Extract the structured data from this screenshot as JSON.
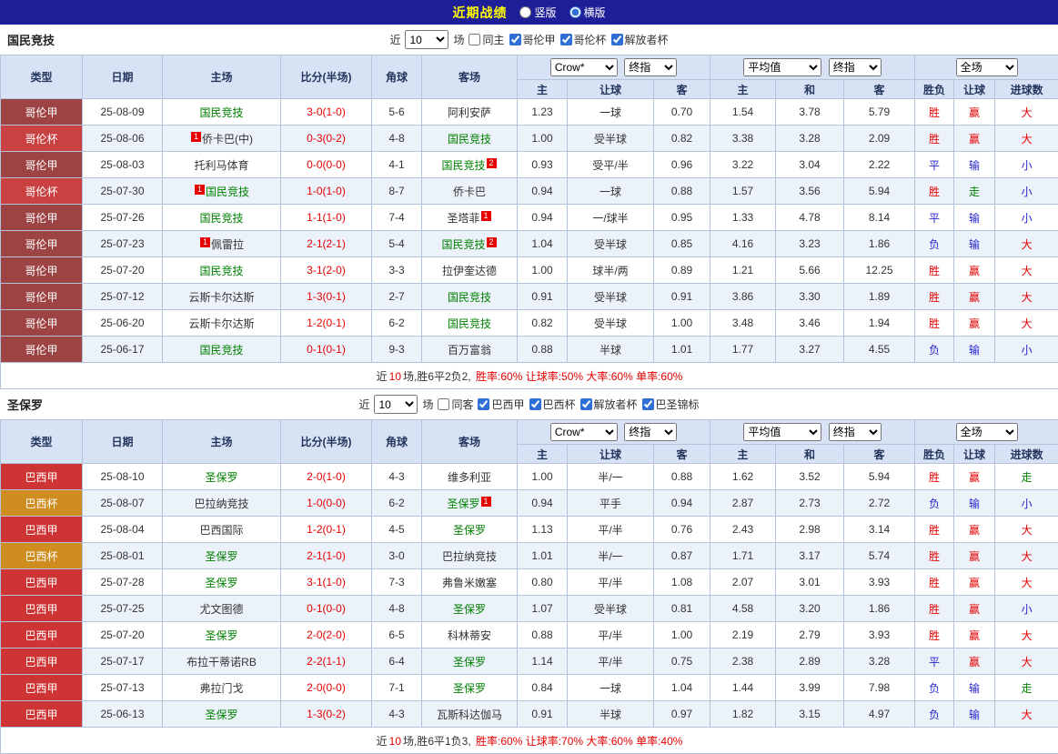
{
  "topbar": {
    "title": "近期战绩",
    "radios": [
      {
        "label": "竖版",
        "checked": false
      },
      {
        "label": "横版",
        "checked": true
      }
    ]
  },
  "columns": {
    "type": "类型",
    "date": "日期",
    "home": "主场",
    "score": "比分(半场)",
    "corner": "角球",
    "away": "客场",
    "odds_sub": [
      "主",
      "让球",
      "客"
    ],
    "avg_sub": [
      "主",
      "和",
      "客"
    ],
    "result_sub": [
      "胜负",
      "让球",
      "进球数"
    ]
  },
  "dropdowns": {
    "odds_company": "Crow*",
    "odds_final": "终指",
    "avg": "平均值",
    "avg_final": "终指",
    "scope": "全场"
  },
  "type_colors": {
    "哥伦甲": "#9e4343",
    "哥伦杯": "#c94141",
    "巴西甲": "#cf3434",
    "巴西杯": "#cf8c1f"
  },
  "sections": [
    {
      "team": "国民竞技",
      "filters": {
        "near": "近",
        "count": "10",
        "games": "场",
        "same": {
          "label": "同主",
          "checked": false
        },
        "leagues": [
          {
            "label": "哥伦甲",
            "checked": true
          },
          {
            "label": "哥伦杯",
            "checked": true
          },
          {
            "label": "解放者杯",
            "checked": true
          }
        ]
      },
      "rows": [
        {
          "type": "哥伦甲",
          "date": "25-08-09",
          "home": {
            "name": "国民竞技",
            "green": true
          },
          "score": "3-0(1-0)",
          "corner": "5-6",
          "away": {
            "name": "阿利安萨"
          },
          "odds": [
            "1.23",
            "一球",
            "0.70"
          ],
          "avg": [
            "1.54",
            "3.78",
            "5.79"
          ],
          "results": [
            [
              "胜",
              "red"
            ],
            [
              "赢",
              "red"
            ],
            [
              "大",
              "red"
            ]
          ]
        },
        {
          "type": "哥伦杯",
          "date": "25-08-06",
          "home": {
            "name": "侨卡巴(中)",
            "badge": "1",
            "badge_pos": "pre"
          },
          "score": "0-3(0-2)",
          "corner": "4-8",
          "away": {
            "name": "国民竞技",
            "green": true
          },
          "odds": [
            "1.00",
            "受半球",
            "0.82"
          ],
          "avg": [
            "3.38",
            "3.28",
            "2.09"
          ],
          "results": [
            [
              "胜",
              "red"
            ],
            [
              "赢",
              "red"
            ],
            [
              "大",
              "red"
            ]
          ]
        },
        {
          "type": "哥伦甲",
          "date": "25-08-03",
          "home": {
            "name": "托利马体育"
          },
          "score": "0-0(0-0)",
          "corner": "4-1",
          "away": {
            "name": "国民竞技",
            "green": true,
            "badge": "2",
            "badge_pos": "post"
          },
          "odds": [
            "0.93",
            "受平/半",
            "0.96"
          ],
          "avg": [
            "3.22",
            "3.04",
            "2.22"
          ],
          "results": [
            [
              "平",
              "blue"
            ],
            [
              "输",
              "blue"
            ],
            [
              "小",
              "blue"
            ]
          ]
        },
        {
          "type": "哥伦杯",
          "date": "25-07-30",
          "home": {
            "name": "国民竞技",
            "green": true,
            "badge": "1",
            "badge_pos": "pre"
          },
          "score": "1-0(1-0)",
          "corner": "8-7",
          "away": {
            "name": "侨卡巴"
          },
          "odds": [
            "0.94",
            "一球",
            "0.88"
          ],
          "avg": [
            "1.57",
            "3.56",
            "5.94"
          ],
          "results": [
            [
              "胜",
              "red"
            ],
            [
              "走",
              "green"
            ],
            [
              "小",
              "blue"
            ]
          ]
        },
        {
          "type": "哥伦甲",
          "date": "25-07-26",
          "home": {
            "name": "国民竞技",
            "green": true
          },
          "score": "1-1(1-0)",
          "corner": "7-4",
          "away": {
            "name": "圣塔菲",
            "badge": "1",
            "badge_pos": "post"
          },
          "odds": [
            "0.94",
            "一/球半",
            "0.95"
          ],
          "avg": [
            "1.33",
            "4.78",
            "8.14"
          ],
          "results": [
            [
              "平",
              "blue"
            ],
            [
              "输",
              "blue"
            ],
            [
              "小",
              "blue"
            ]
          ]
        },
        {
          "type": "哥伦甲",
          "date": "25-07-23",
          "home": {
            "name": "佩雷拉",
            "badge": "1",
            "badge_pos": "pre"
          },
          "score": "2-1(2-1)",
          "corner": "5-4",
          "away": {
            "name": "国民竞技",
            "green": true,
            "badge": "2",
            "badge_pos": "post"
          },
          "odds": [
            "1.04",
            "受半球",
            "0.85"
          ],
          "avg": [
            "4.16",
            "3.23",
            "1.86"
          ],
          "results": [
            [
              "负",
              "blue"
            ],
            [
              "输",
              "blue"
            ],
            [
              "大",
              "red"
            ]
          ]
        },
        {
          "type": "哥伦甲",
          "date": "25-07-20",
          "home": {
            "name": "国民竞技",
            "green": true
          },
          "score": "3-1(2-0)",
          "corner": "3-3",
          "away": {
            "name": "拉伊奎达德"
          },
          "odds": [
            "1.00",
            "球半/两",
            "0.89"
          ],
          "avg": [
            "1.21",
            "5.66",
            "12.25"
          ],
          "results": [
            [
              "胜",
              "red"
            ],
            [
              "赢",
              "red"
            ],
            [
              "大",
              "red"
            ]
          ]
        },
        {
          "type": "哥伦甲",
          "date": "25-07-12",
          "home": {
            "name": "云斯卡尔达斯"
          },
          "score": "1-3(0-1)",
          "corner": "2-7",
          "away": {
            "name": "国民竞技",
            "green": true
          },
          "odds": [
            "0.91",
            "受半球",
            "0.91"
          ],
          "avg": [
            "3.86",
            "3.30",
            "1.89"
          ],
          "results": [
            [
              "胜",
              "red"
            ],
            [
              "赢",
              "red"
            ],
            [
              "大",
              "red"
            ]
          ]
        },
        {
          "type": "哥伦甲",
          "date": "25-06-20",
          "home": {
            "name": "云斯卡尔达斯"
          },
          "score": "1-2(0-1)",
          "corner": "6-2",
          "away": {
            "name": "国民竞技",
            "green": true
          },
          "odds": [
            "0.82",
            "受半球",
            "1.00"
          ],
          "avg": [
            "3.48",
            "3.46",
            "1.94"
          ],
          "results": [
            [
              "胜",
              "red"
            ],
            [
              "赢",
              "red"
            ],
            [
              "大",
              "red"
            ]
          ]
        },
        {
          "type": "哥伦甲",
          "date": "25-06-17",
          "home": {
            "name": "国民竞技",
            "green": true
          },
          "score": "0-1(0-1)",
          "corner": "9-3",
          "away": {
            "name": "百万富翁"
          },
          "odds": [
            "0.88",
            "半球",
            "1.01"
          ],
          "avg": [
            "1.77",
            "3.27",
            "4.55"
          ],
          "results": [
            [
              "负",
              "blue"
            ],
            [
              "输",
              "blue"
            ],
            [
              "小",
              "blue"
            ]
          ]
        }
      ],
      "summary": {
        "prefix": "近",
        "count": "10",
        "mid": "场,胜6平2负2,",
        "stats": " 胜率:60% 让球率:50% 大率:60% 单率:60%"
      }
    },
    {
      "team": "圣保罗",
      "filters": {
        "near": "近",
        "count": "10",
        "games": "场",
        "same": {
          "label": "同客",
          "checked": false
        },
        "leagues": [
          {
            "label": "巴西甲",
            "checked": true
          },
          {
            "label": "巴西杯",
            "checked": true
          },
          {
            "label": "解放者杯",
            "checked": true
          },
          {
            "label": "巴圣锦标",
            "checked": true
          }
        ]
      },
      "rows": [
        {
          "type": "巴西甲",
          "date": "25-08-10",
          "home": {
            "name": "圣保罗",
            "green": true
          },
          "score": "2-0(1-0)",
          "corner": "4-3",
          "away": {
            "name": "维多利亚"
          },
          "odds": [
            "1.00",
            "半/一",
            "0.88"
          ],
          "avg": [
            "1.62",
            "3.52",
            "5.94"
          ],
          "results": [
            [
              "胜",
              "red"
            ],
            [
              "赢",
              "red"
            ],
            [
              "走",
              "green"
            ]
          ]
        },
        {
          "type": "巴西杯",
          "date": "25-08-07",
          "home": {
            "name": "巴拉纳竞技"
          },
          "score": "1-0(0-0)",
          "corner": "6-2",
          "away": {
            "name": "圣保罗",
            "green": true,
            "badge": "1",
            "badge_pos": "post"
          },
          "odds": [
            "0.94",
            "平手",
            "0.94"
          ],
          "avg": [
            "2.87",
            "2.73",
            "2.72"
          ],
          "results": [
            [
              "负",
              "blue"
            ],
            [
              "输",
              "blue"
            ],
            [
              "小",
              "blue"
            ]
          ]
        },
        {
          "type": "巴西甲",
          "date": "25-08-04",
          "home": {
            "name": "巴西国际"
          },
          "score": "1-2(0-1)",
          "corner": "4-5",
          "away": {
            "name": "圣保罗",
            "green": true
          },
          "odds": [
            "1.13",
            "平/半",
            "0.76"
          ],
          "avg": [
            "2.43",
            "2.98",
            "3.14"
          ],
          "results": [
            [
              "胜",
              "red"
            ],
            [
              "赢",
              "red"
            ],
            [
              "大",
              "red"
            ]
          ]
        },
        {
          "type": "巴西杯",
          "date": "25-08-01",
          "home": {
            "name": "圣保罗",
            "green": true
          },
          "score": "2-1(1-0)",
          "corner": "3-0",
          "away": {
            "name": "巴拉纳竞技"
          },
          "odds": [
            "1.01",
            "半/一",
            "0.87"
          ],
          "avg": [
            "1.71",
            "3.17",
            "5.74"
          ],
          "results": [
            [
              "胜",
              "red"
            ],
            [
              "赢",
              "red"
            ],
            [
              "大",
              "red"
            ]
          ]
        },
        {
          "type": "巴西甲",
          "date": "25-07-28",
          "home": {
            "name": "圣保罗",
            "green": true
          },
          "score": "3-1(1-0)",
          "corner": "7-3",
          "away": {
            "name": "弗鲁米嫩塞"
          },
          "odds": [
            "0.80",
            "平/半",
            "1.08"
          ],
          "avg": [
            "2.07",
            "3.01",
            "3.93"
          ],
          "results": [
            [
              "胜",
              "red"
            ],
            [
              "赢",
              "red"
            ],
            [
              "大",
              "red"
            ]
          ]
        },
        {
          "type": "巴西甲",
          "date": "25-07-25",
          "home": {
            "name": "尤文图德"
          },
          "score": "0-1(0-0)",
          "corner": "4-8",
          "away": {
            "name": "圣保罗",
            "green": true
          },
          "odds": [
            "1.07",
            "受半球",
            "0.81"
          ],
          "avg": [
            "4.58",
            "3.20",
            "1.86"
          ],
          "results": [
            [
              "胜",
              "red"
            ],
            [
              "赢",
              "red"
            ],
            [
              "小",
              "blue"
            ]
          ]
        },
        {
          "type": "巴西甲",
          "date": "25-07-20",
          "home": {
            "name": "圣保罗",
            "green": true
          },
          "score": "2-0(2-0)",
          "corner": "6-5",
          "away": {
            "name": "科林蒂安"
          },
          "odds": [
            "0.88",
            "平/半",
            "1.00"
          ],
          "avg": [
            "2.19",
            "2.79",
            "3.93"
          ],
          "results": [
            [
              "胜",
              "red"
            ],
            [
              "赢",
              "red"
            ],
            [
              "大",
              "red"
            ]
          ]
        },
        {
          "type": "巴西甲",
          "date": "25-07-17",
          "home": {
            "name": "布拉干蒂诺RB"
          },
          "score": "2-2(1-1)",
          "corner": "6-4",
          "away": {
            "name": "圣保罗",
            "green": true
          },
          "odds": [
            "1.14",
            "平/半",
            "0.75"
          ],
          "avg": [
            "2.38",
            "2.89",
            "3.28"
          ],
          "results": [
            [
              "平",
              "blue"
            ],
            [
              "赢",
              "red"
            ],
            [
              "大",
              "red"
            ]
          ]
        },
        {
          "type": "巴西甲",
          "date": "25-07-13",
          "home": {
            "name": "弗拉门戈"
          },
          "score": "2-0(0-0)",
          "corner": "7-1",
          "away": {
            "name": "圣保罗",
            "green": true
          },
          "odds": [
            "0.84",
            "一球",
            "1.04"
          ],
          "avg": [
            "1.44",
            "3.99",
            "7.98"
          ],
          "results": [
            [
              "负",
              "blue"
            ],
            [
              "输",
              "blue"
            ],
            [
              "走",
              "green"
            ]
          ]
        },
        {
          "type": "巴西甲",
          "date": "25-06-13",
          "home": {
            "name": "圣保罗",
            "green": true
          },
          "score": "1-3(0-2)",
          "corner": "4-3",
          "away": {
            "name": "瓦斯科达伽马"
          },
          "odds": [
            "0.91",
            "半球",
            "0.97"
          ],
          "avg": [
            "1.82",
            "3.15",
            "4.97"
          ],
          "results": [
            [
              "负",
              "blue"
            ],
            [
              "输",
              "blue"
            ],
            [
              "大",
              "red"
            ]
          ]
        }
      ],
      "summary": {
        "prefix": "近",
        "count": "10",
        "mid": "场,胜6平1负3,",
        "stats": " 胜率:60% 让球率:70% 大率:60% 单率:40%"
      }
    }
  ]
}
